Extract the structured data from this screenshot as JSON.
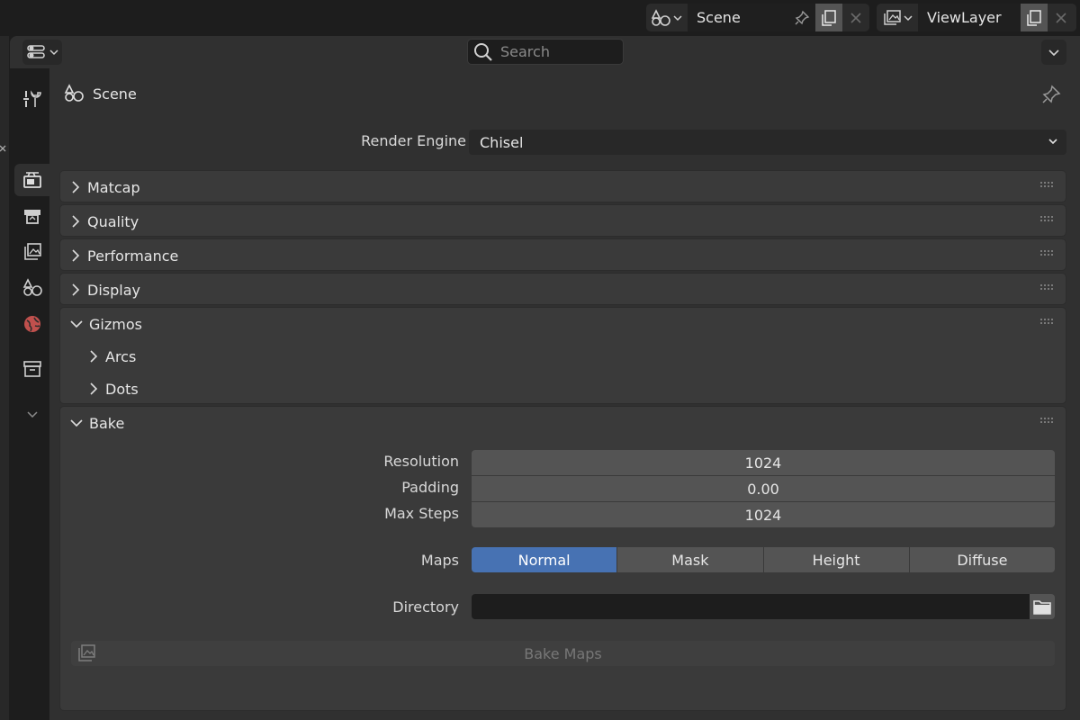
{
  "topbar": {
    "scene_name": "Scene",
    "view_layer_name": "ViewLayer"
  },
  "header": {
    "search_placeholder": "Search"
  },
  "context": {
    "label": "Scene"
  },
  "render_engine": {
    "label": "Render Engine",
    "value": "Chisel"
  },
  "panels": {
    "matcap": "Matcap",
    "quality": "Quality",
    "performance": "Performance",
    "display": "Display",
    "gizmos": "Gizmos",
    "arcs": "Arcs",
    "dots": "Dots",
    "bake": "Bake"
  },
  "bake": {
    "resolution_label": "Resolution",
    "resolution_value": "1024",
    "padding_label": "Padding",
    "padding_value": "0.00",
    "max_steps_label": "Max Steps",
    "max_steps_value": "1024",
    "maps_label": "Maps",
    "maps_options": [
      "Normal",
      "Mask",
      "Height",
      "Diffuse"
    ],
    "maps_selected": "Normal",
    "directory_label": "Directory",
    "directory_value": "",
    "bake_button": "Bake Maps"
  },
  "colors": {
    "accent": "#4772b3",
    "panel_bg": "#3a3a3a",
    "editor_bg": "#303030",
    "field_bg": "#545454"
  }
}
